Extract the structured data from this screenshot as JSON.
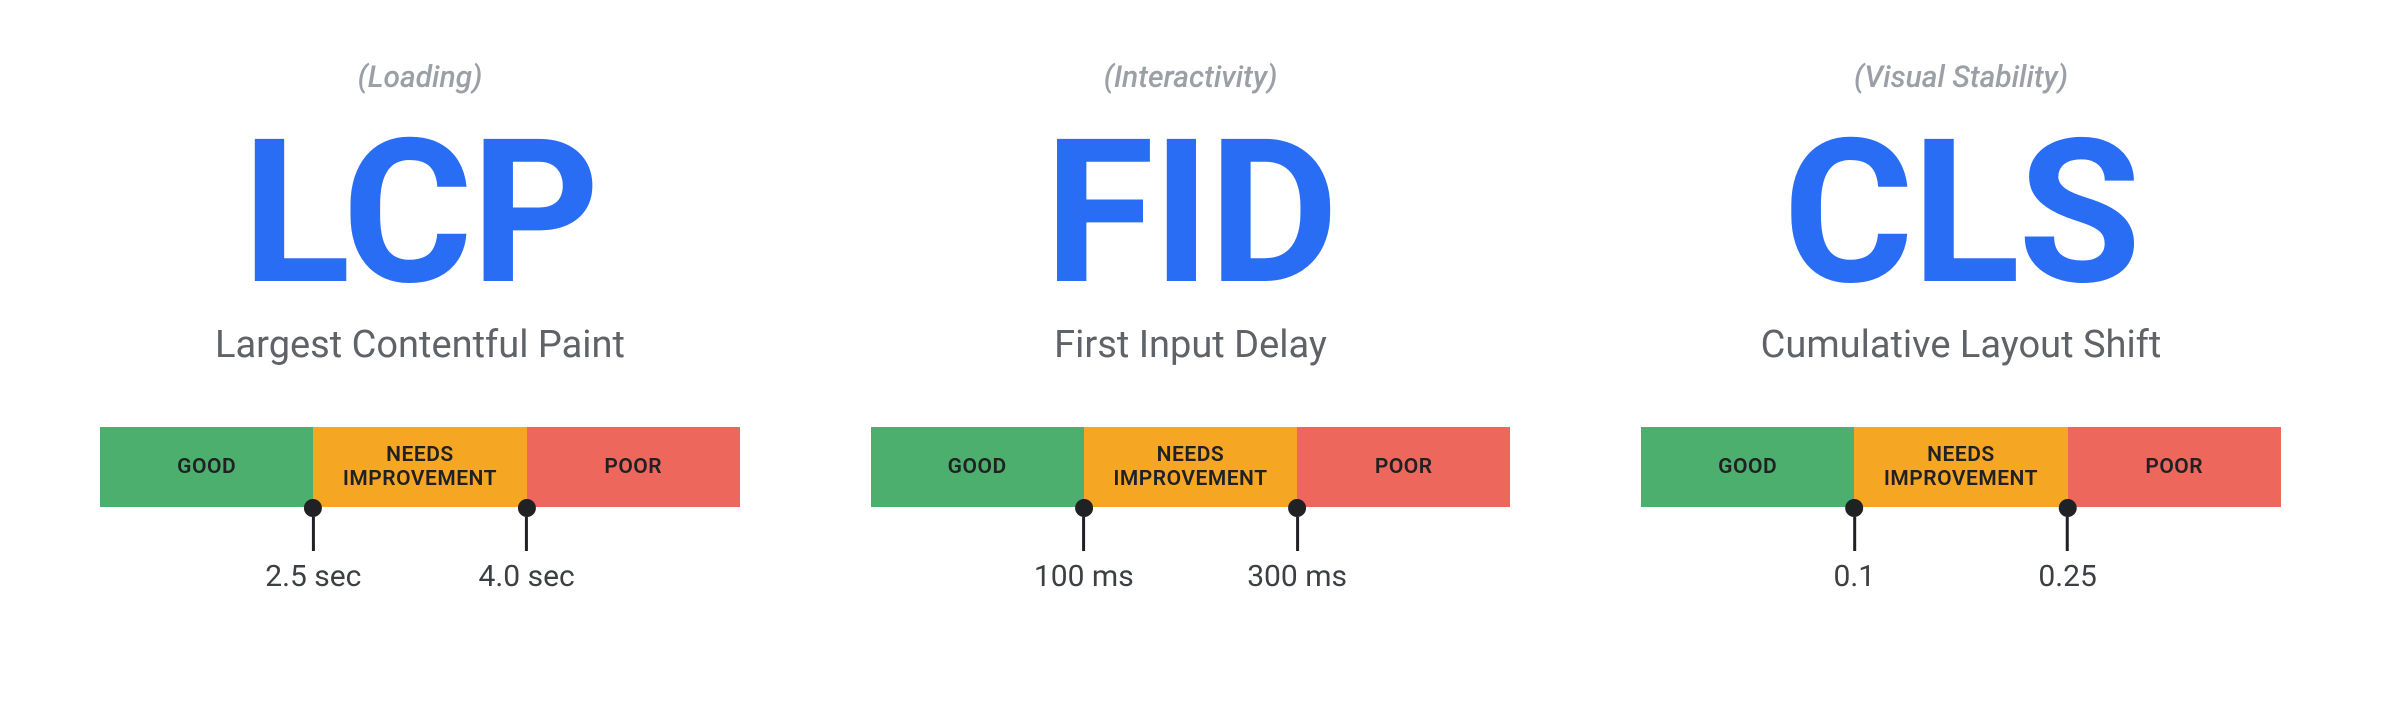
{
  "colors": {
    "accent": "#2a6df5",
    "good": "#4caf6d",
    "needs": "#f5a623",
    "poor": "#ee675c"
  },
  "zones": {
    "good": "GOOD",
    "needs_line1": "NEEDS",
    "needs_line2": "IMPROVEMENT",
    "poor": "POOR"
  },
  "metrics": [
    {
      "category": "(Loading)",
      "acronym": "LCP",
      "name": "Largest Contentful Paint",
      "threshold1": "2.5 sec",
      "threshold2": "4.0 sec"
    },
    {
      "category": "(Interactivity)",
      "acronym": "FID",
      "name": "First Input Delay",
      "threshold1": "100 ms",
      "threshold2": "300 ms"
    },
    {
      "category": "(Visual Stability)",
      "acronym": "CLS",
      "name": "Cumulative Layout Shift",
      "threshold1": "0.1",
      "threshold2": "0.25"
    }
  ]
}
